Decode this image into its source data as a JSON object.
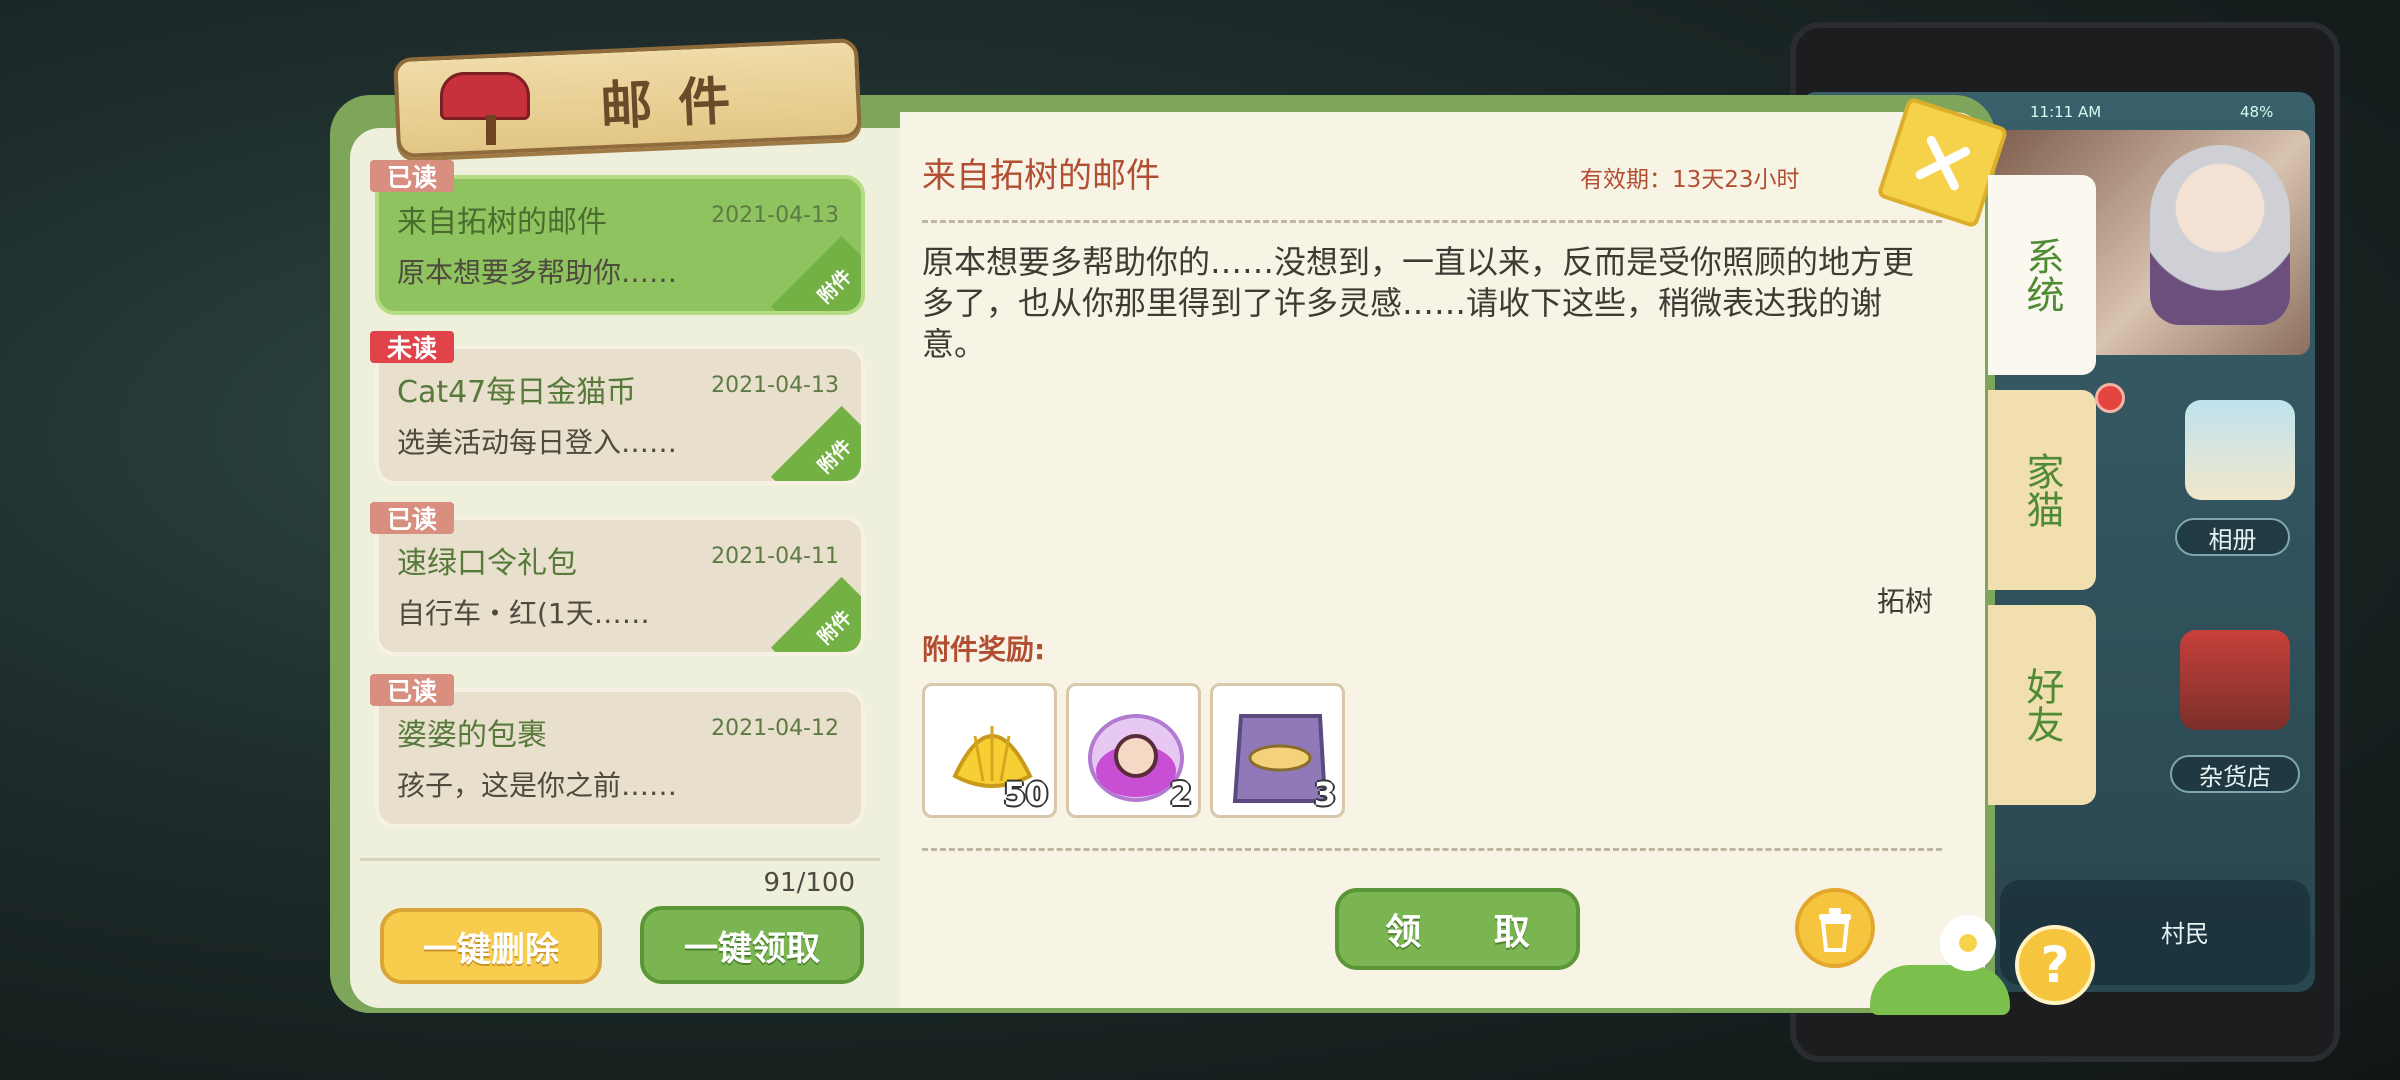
{
  "header": {
    "title": "邮件"
  },
  "mail_list": {
    "items": [
      {
        "status": "已读",
        "status_type": "read",
        "title": "来自拓树的邮件",
        "date": "2021-04-13",
        "preview": "原本想要多帮助你……",
        "attachment": "附件",
        "selected": true
      },
      {
        "status": "未读",
        "status_type": "unread",
        "title": "Cat47每日金猫币",
        "date": "2021-04-13",
        "preview": "选美活动每日登入……",
        "attachment": "附件",
        "selected": false
      },
      {
        "status": "已读",
        "status_type": "read",
        "title": "速绿口令礼包",
        "date": "2021-04-11",
        "preview": "自行车・红(1天……",
        "attachment": "附件",
        "selected": false
      },
      {
        "status": "已读",
        "status_type": "read",
        "title": "婆婆的包裹",
        "date": "2021-04-12",
        "preview": "孩子，这是你之前……",
        "attachment": "",
        "selected": false
      }
    ],
    "count": "91/100",
    "delete_all_label": "一键删除",
    "claim_all_label": "一键领取"
  },
  "detail": {
    "title": "来自拓树的邮件",
    "validity": "有效期：13天23小时",
    "body": "原本想要多帮助你的……没想到，一直以来，反而是受你照顾的地方更多了，也从你那里得到了许多灵感……请收下这些，稍微表达我的谢意。",
    "signature": "拓树",
    "attachment_heading": "附件奖励:",
    "rewards": [
      {
        "icon": "gold-shell-icon",
        "qty": "50"
      },
      {
        "icon": "portrait-jar-icon",
        "qty": "2"
      },
      {
        "icon": "fish-bag-icon",
        "qty": "3"
      }
    ],
    "claim_label": "领  取"
  },
  "side_tabs": [
    {
      "label": "系统",
      "active": true
    },
    {
      "label": "家猫",
      "active": false
    },
    {
      "label": "好友",
      "active": false
    }
  ],
  "background_phone": {
    "time": "11:11 AM",
    "battery": "48%",
    "apps": [
      "相册",
      "杂货店"
    ],
    "dock": [
      "村民"
    ]
  },
  "colors": {
    "panel_green": "#7ea65b",
    "accent_red": "#b24f32",
    "button_green": "#7ab552",
    "button_yellow": "#f8cd4e",
    "unread_red": "#e0434a",
    "read_pink": "#d88f80"
  }
}
